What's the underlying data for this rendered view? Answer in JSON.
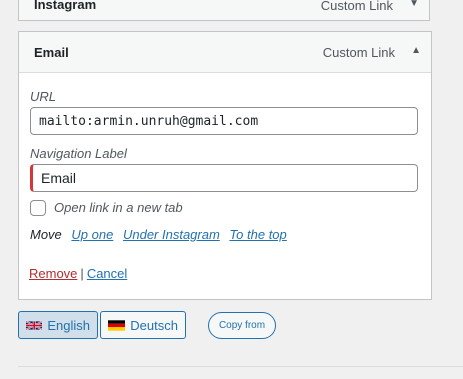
{
  "previous_item": {
    "title": "Instagram",
    "type": "Custom Link"
  },
  "menu_item": {
    "title": "Email",
    "type": "Custom Link",
    "toggle": "▲",
    "url_label": "URL",
    "url_value": "mailto:armin.unruh@gmail.com",
    "nav_label_label": "Navigation Label",
    "nav_label_value": "Email",
    "new_tab_label": "Open link in a new tab",
    "move_label": "Move",
    "move_links": [
      "Up one",
      "Under Instagram",
      "To the top"
    ],
    "remove_label": "Remove",
    "separator": "|",
    "cancel_label": "Cancel"
  },
  "languages": [
    {
      "label": "English",
      "flag": "uk-flag-icon",
      "active": true
    },
    {
      "label": "Deutsch",
      "flag": "de-flag-icon",
      "active": false
    }
  ],
  "copy_from_label": "Copy from",
  "colors": {
    "accent": "#2271b1",
    "remove": "#b32d2e",
    "active_border": "#d63638"
  }
}
